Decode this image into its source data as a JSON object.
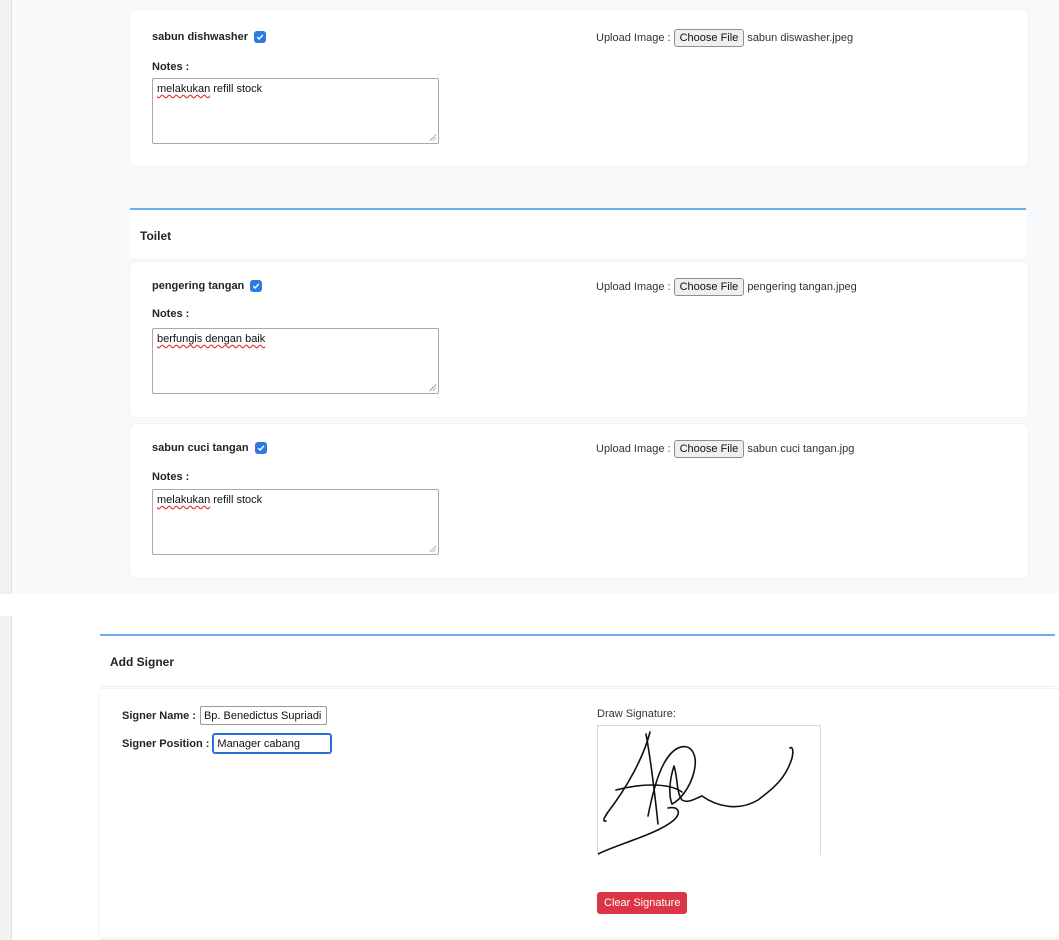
{
  "top_items": [
    {
      "name": "sabun dishwasher",
      "checked": true,
      "notes_label": "Notes :",
      "notes_text": "melakukan refill stock",
      "squiggle_word": "melakukan",
      "upload_label": "Upload Image :",
      "choose_label": "Choose File",
      "file_name": "sabun diswasher.jpeg"
    }
  ],
  "section": {
    "title": "Toilet"
  },
  "section_items": [
    {
      "name": "pengering tangan",
      "checked": true,
      "notes_label": "Notes :",
      "notes_text": "berfungis dengan baik",
      "upload_label": "Upload Image :",
      "choose_label": "Choose File",
      "file_name": "pengering tangan.jpeg"
    },
    {
      "name": "sabun cuci tangan",
      "checked": true,
      "notes_label": "Notes :",
      "notes_text": "melakukan refill stock",
      "upload_label": "Upload Image :",
      "choose_label": "Choose File",
      "file_name": "sabun cuci tangan.jpg"
    }
  ],
  "signer": {
    "title": "Add Signer",
    "name_label": "Signer Name :",
    "name_value": "Bp. Benedictus Supriadi",
    "position_label": "Signer Position :",
    "position_value": "Manager cabang",
    "draw_label": "Draw Signature:",
    "clear_label": "Clear Signature"
  },
  "colors": {
    "accent_blue": "#2c7be5",
    "section_border": "#6aaef0",
    "danger": "#dc3545"
  }
}
